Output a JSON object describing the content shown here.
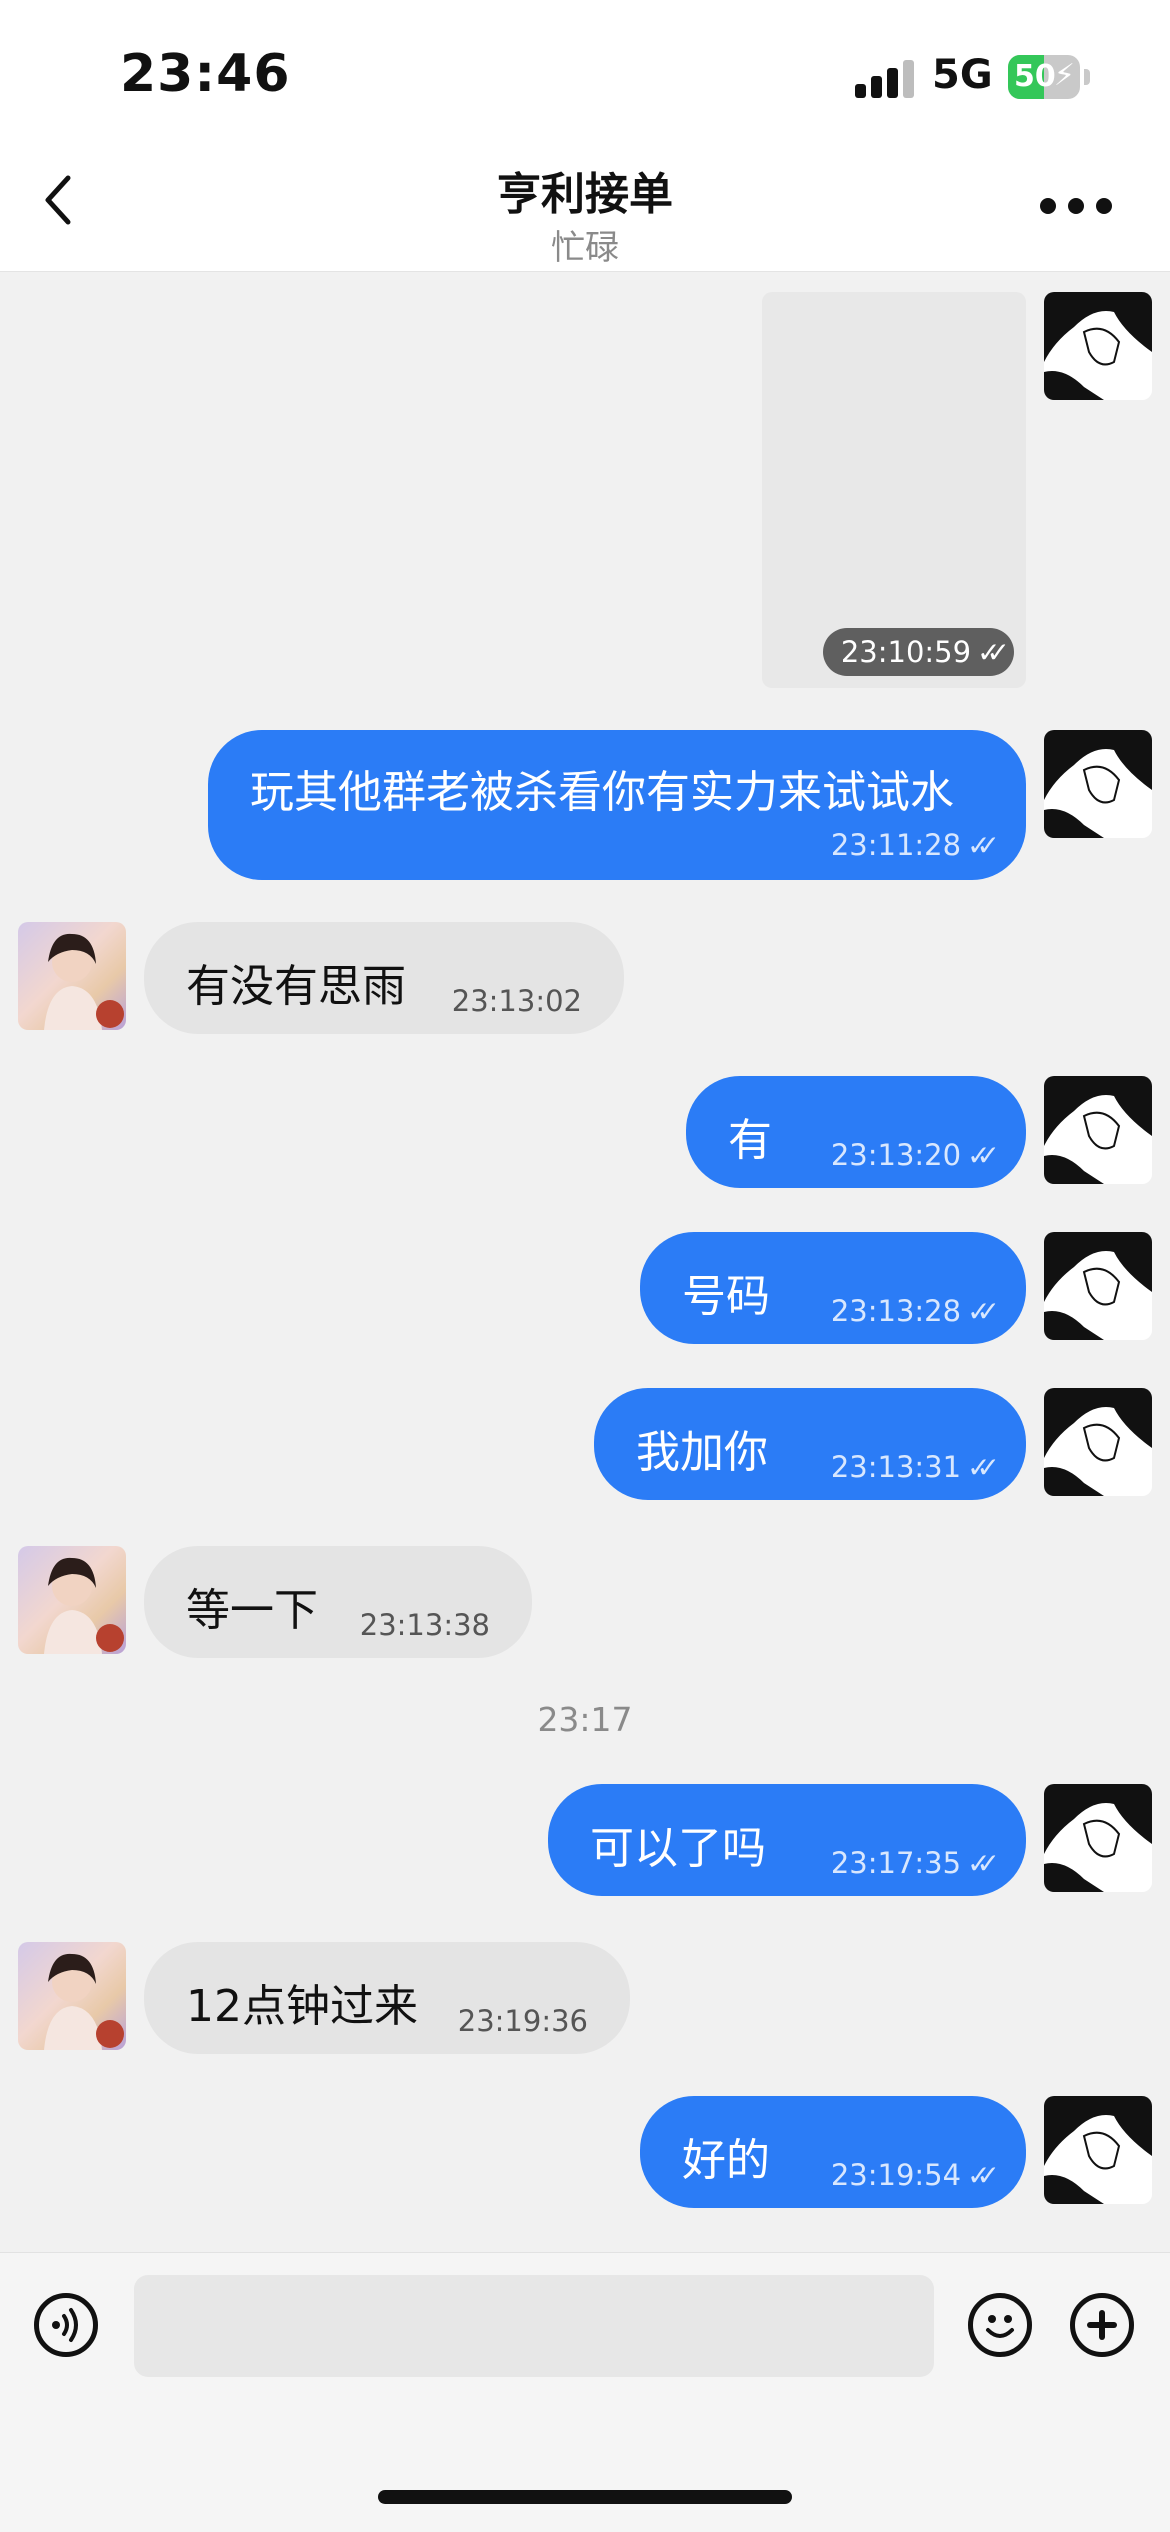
{
  "status_bar": {
    "time": "23:46",
    "network": "5G",
    "battery": "50",
    "battery_level": 0.5
  },
  "header": {
    "title": "亨利接单",
    "subtitle": "忙碌"
  },
  "icons": {
    "back": "chevron-left-icon",
    "more": "more-dots-icon",
    "voice": "voice-icon",
    "emoji": "emoji-icon",
    "plus": "plus-icon",
    "read": "double-check-icon"
  },
  "colors": {
    "sent_bubble": "#2b7cf6",
    "received_bubble": "#e4e4e4",
    "background": "#f1f1f1"
  },
  "messages": [
    {
      "from": "me",
      "type": "image",
      "time": "23:10:59"
    },
    {
      "from": "me",
      "type": "text",
      "text": "玩其他群老被杀看你有实力来试试水",
      "time": "23:11:28"
    },
    {
      "from": "other",
      "type": "text",
      "text": "有没有思雨",
      "time": "23:13:02"
    },
    {
      "from": "me",
      "type": "text",
      "text": "有",
      "time": "23:13:20"
    },
    {
      "from": "me",
      "type": "text",
      "text": "号码",
      "time": "23:13:28"
    },
    {
      "from": "me",
      "type": "text",
      "text": "我加你",
      "time": "23:13:31"
    },
    {
      "from": "other",
      "type": "text",
      "text": "等一下",
      "time": "23:13:38"
    },
    {
      "from": "system",
      "type": "time",
      "text": "23:17"
    },
    {
      "from": "me",
      "type": "text",
      "text": "可以了吗",
      "time": "23:17:35"
    },
    {
      "from": "other",
      "type": "text",
      "text": "12点钟过来",
      "time": "23:19:36"
    },
    {
      "from": "me",
      "type": "text",
      "text": "好的",
      "time": "23:19:54"
    }
  ],
  "composer": {
    "value": "",
    "placeholder": ""
  }
}
